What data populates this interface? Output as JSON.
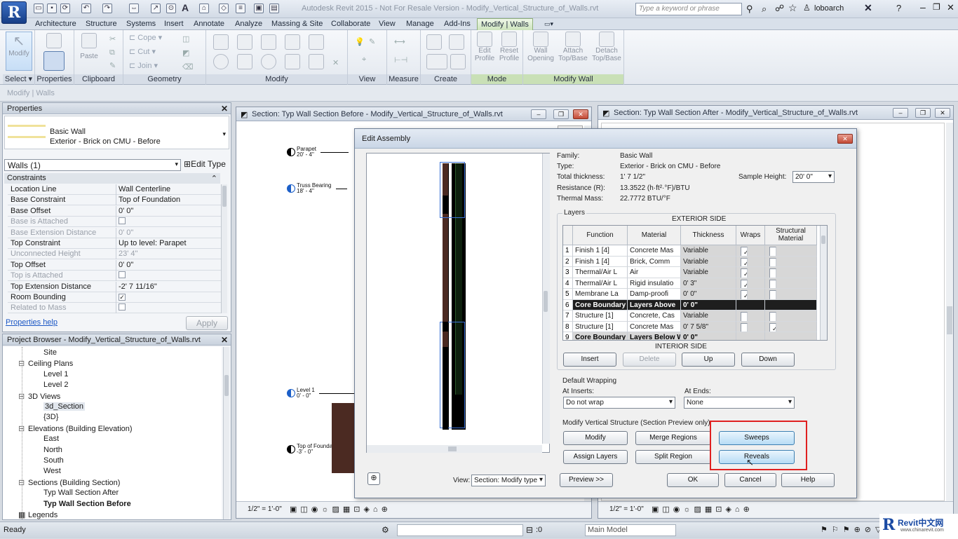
{
  "app": {
    "logo": "R",
    "window_title": "Autodesk Revit 2015 - Not For Resale Version -  Modify_Vertical_Structure_of_Walls.rvt",
    "search_placeholder": "Type a keyword or phrase",
    "user": "loboarch"
  },
  "tabs": [
    "Architecture",
    "Structure",
    "Systems",
    "Insert",
    "Annotate",
    "Analyze",
    "Massing & Site",
    "Collaborate",
    "View",
    "Manage",
    "Add-Ins",
    "Modify | Walls"
  ],
  "ribbon": {
    "groups": [
      "Select",
      "Properties",
      "Clipboard",
      "Geometry",
      "Modify",
      "View",
      "Measure",
      "Create",
      "Mode",
      "Modify Wall"
    ],
    "select_dropdown": "Select ▾",
    "buttons": {
      "modify": "Modify",
      "paste": "Paste",
      "cope": "Cope",
      "cut": "Cut",
      "join": "Join",
      "edit_profile": "Edit Profile",
      "reset_profile": "Reset Profile",
      "wall_opening": "Wall Opening",
      "attach": "Attach Top/Base",
      "detach": "Detach Top/Base"
    }
  },
  "context_bar": "Modify | Walls",
  "properties": {
    "title": "Properties",
    "type_family": "Basic Wall",
    "type_name": "Exterior - Brick on CMU - Before",
    "selector": "Walls (1)",
    "edit_type": "Edit Type",
    "section": "Constraints",
    "rows": [
      {
        "k": "Location Line",
        "v": "Wall Centerline",
        "dim": false
      },
      {
        "k": "Base Constraint",
        "v": "Top of Foundation",
        "dim": false
      },
      {
        "k": "Base Offset",
        "v": "0'  0\"",
        "dim": false
      },
      {
        "k": "Base is Attached",
        "v": "",
        "dim": true,
        "check": false
      },
      {
        "k": "Base Extension Distance",
        "v": "0'  0\"",
        "dim": true
      },
      {
        "k": "Top Constraint",
        "v": "Up to level: Parapet",
        "dim": false
      },
      {
        "k": "Unconnected Height",
        "v": "23'  4\"",
        "dim": true
      },
      {
        "k": "Top Offset",
        "v": "0'  0\"",
        "dim": false
      },
      {
        "k": "Top is Attached",
        "v": "",
        "dim": true,
        "check": false
      },
      {
        "k": "Top Extension Distance",
        "v": "-2'  7 11/16\"",
        "dim": false
      },
      {
        "k": "Room Bounding",
        "v": "",
        "dim": false,
        "check": true
      },
      {
        "k": "Related to Mass",
        "v": "",
        "dim": true,
        "check": false
      }
    ],
    "help_link": "Properties help",
    "apply": "Apply"
  },
  "browser": {
    "title": "Project Browser - Modify_Vertical_Structure_of_Walls.rvt",
    "items": [
      {
        "t": "Site",
        "lvl": 2
      },
      {
        "t": "Ceiling Plans",
        "lvl": 1
      },
      {
        "t": "Level 1",
        "lvl": 2
      },
      {
        "t": "Level 2",
        "lvl": 2
      },
      {
        "t": "3D Views",
        "lvl": 1
      },
      {
        "t": "3d_Section",
        "lvl": 2
      },
      {
        "t": "{3D}",
        "lvl": 2
      },
      {
        "t": "Elevations (Building Elevation)",
        "lvl": 1
      },
      {
        "t": "East",
        "lvl": 2
      },
      {
        "t": "North",
        "lvl": 2
      },
      {
        "t": "South",
        "lvl": 2
      },
      {
        "t": "West",
        "lvl": 2
      },
      {
        "t": "Sections (Building Section)",
        "lvl": 1
      },
      {
        "t": "Typ Wall Section After",
        "lvl": 2
      },
      {
        "t": "Typ Wall Section Before",
        "lvl": 2
      },
      {
        "t": "Legends",
        "lvl": 0
      }
    ]
  },
  "view_left": {
    "title": "Section: Typ Wall Section Before - Modify_Vertical_Structure_of_Walls.rvt",
    "scale": "1/2\" = 1'-0\"",
    "levels": [
      {
        "name": "Parapet",
        "elev": "20' - 4\""
      },
      {
        "name": "Truss Bearing",
        "elev": "18' - 4\""
      },
      {
        "name": "Level 1",
        "elev": "0' - 0\""
      },
      {
        "name": "Top of Foundation",
        "elev": "-3' - 0\""
      }
    ]
  },
  "view_right": {
    "title": "Section: Typ Wall Section After - Modify_Vertical_Structure_of_Walls.rvt",
    "scale": "1/2\" = 1'-0\""
  },
  "dialog": {
    "title": "Edit Assembly",
    "family_label": "Family:",
    "family": "Basic Wall",
    "type_label": "Type:",
    "type": "Exterior - Brick on CMU - Before",
    "thick_label": "Total thickness:",
    "thick": "1'  7 1/2\"",
    "res_label": "Resistance (R):",
    "res": "13.3522 (h·ft²·°F)/BTU",
    "mass_label": "Thermal Mass:",
    "mass": "22.7772 BTU/°F",
    "sample_label": "Sample Height:",
    "sample": "20'  0\"",
    "layers_label": "Layers",
    "exterior": "EXTERIOR SIDE",
    "interior": "INTERIOR SIDE",
    "cols": [
      "Function",
      "Material",
      "Thickness",
      "Wraps",
      "Structural Material"
    ],
    "rows": [
      {
        "n": "1",
        "f": "Finish 1 [4]",
        "m": "Concrete Mas",
        "t": "Variable",
        "w": true,
        "s": false,
        "core": false
      },
      {
        "n": "2",
        "f": "Finish 1 [4]",
        "m": "Brick, Comm",
        "t": "Variable",
        "w": true,
        "s": false,
        "core": false
      },
      {
        "n": "3",
        "f": "Thermal/Air L",
        "m": "Air",
        "t": "Variable",
        "w": true,
        "s": false,
        "core": false
      },
      {
        "n": "4",
        "f": "Thermal/Air L",
        "m": "Rigid insulatio",
        "t": "0'  3\"",
        "w": true,
        "s": false,
        "core": false
      },
      {
        "n": "5",
        "f": "Membrane La",
        "m": "Damp-proofi",
        "t": "0'  0\"",
        "w": true,
        "s": false,
        "core": false
      },
      {
        "n": "6",
        "f": "Core Boundary",
        "m": "Layers Above",
        "t": "0'  0\"",
        "w": null,
        "s": null,
        "core": true
      },
      {
        "n": "7",
        "f": "Structure [1]",
        "m": "Concrete, Cas",
        "t": "Variable",
        "w": false,
        "s": false,
        "core": false
      },
      {
        "n": "8",
        "f": "Structure [1]",
        "m": "Concrete Mas",
        "t": "0'  7 5/8\"",
        "w": false,
        "s": true,
        "core": false
      },
      {
        "n": "9",
        "f": "Core Boundary",
        "m": "Layers Below W",
        "t": "0'  0\"",
        "w": null,
        "s": null,
        "core": true,
        "light": true
      }
    ],
    "btn_insert": "Insert",
    "btn_delete": "Delete",
    "btn_up": "Up",
    "btn_down": "Down",
    "wrap_label": "Default Wrapping",
    "inserts_label": "At Inserts:",
    "inserts": "Do not wrap",
    "ends_label": "At Ends:",
    "ends": "None",
    "mvs_label": "Modify Vertical Structure (Section Preview only)",
    "btn_modify": "Modify",
    "btn_merge": "Merge Regions",
    "btn_sweeps": "Sweeps",
    "btn_assign": "Assign Layers",
    "btn_split": "Split Region",
    "btn_reveals": "Reveals",
    "view_label": "View:",
    "view_value": "Section: Modify type",
    "btn_preview": "Preview >>",
    "btn_ok": "OK",
    "btn_cancel": "Cancel",
    "btn_help": "Help"
  },
  "status": {
    "text": "Ready",
    "zero": ":0",
    "model": "Main Model",
    "brand": "Revit中文网",
    "brand_url": "www.chinarevit.com"
  },
  "colors": {
    "highlight": "#e02020",
    "core": "#1e1e1e",
    "brick": "#4b2a22"
  }
}
